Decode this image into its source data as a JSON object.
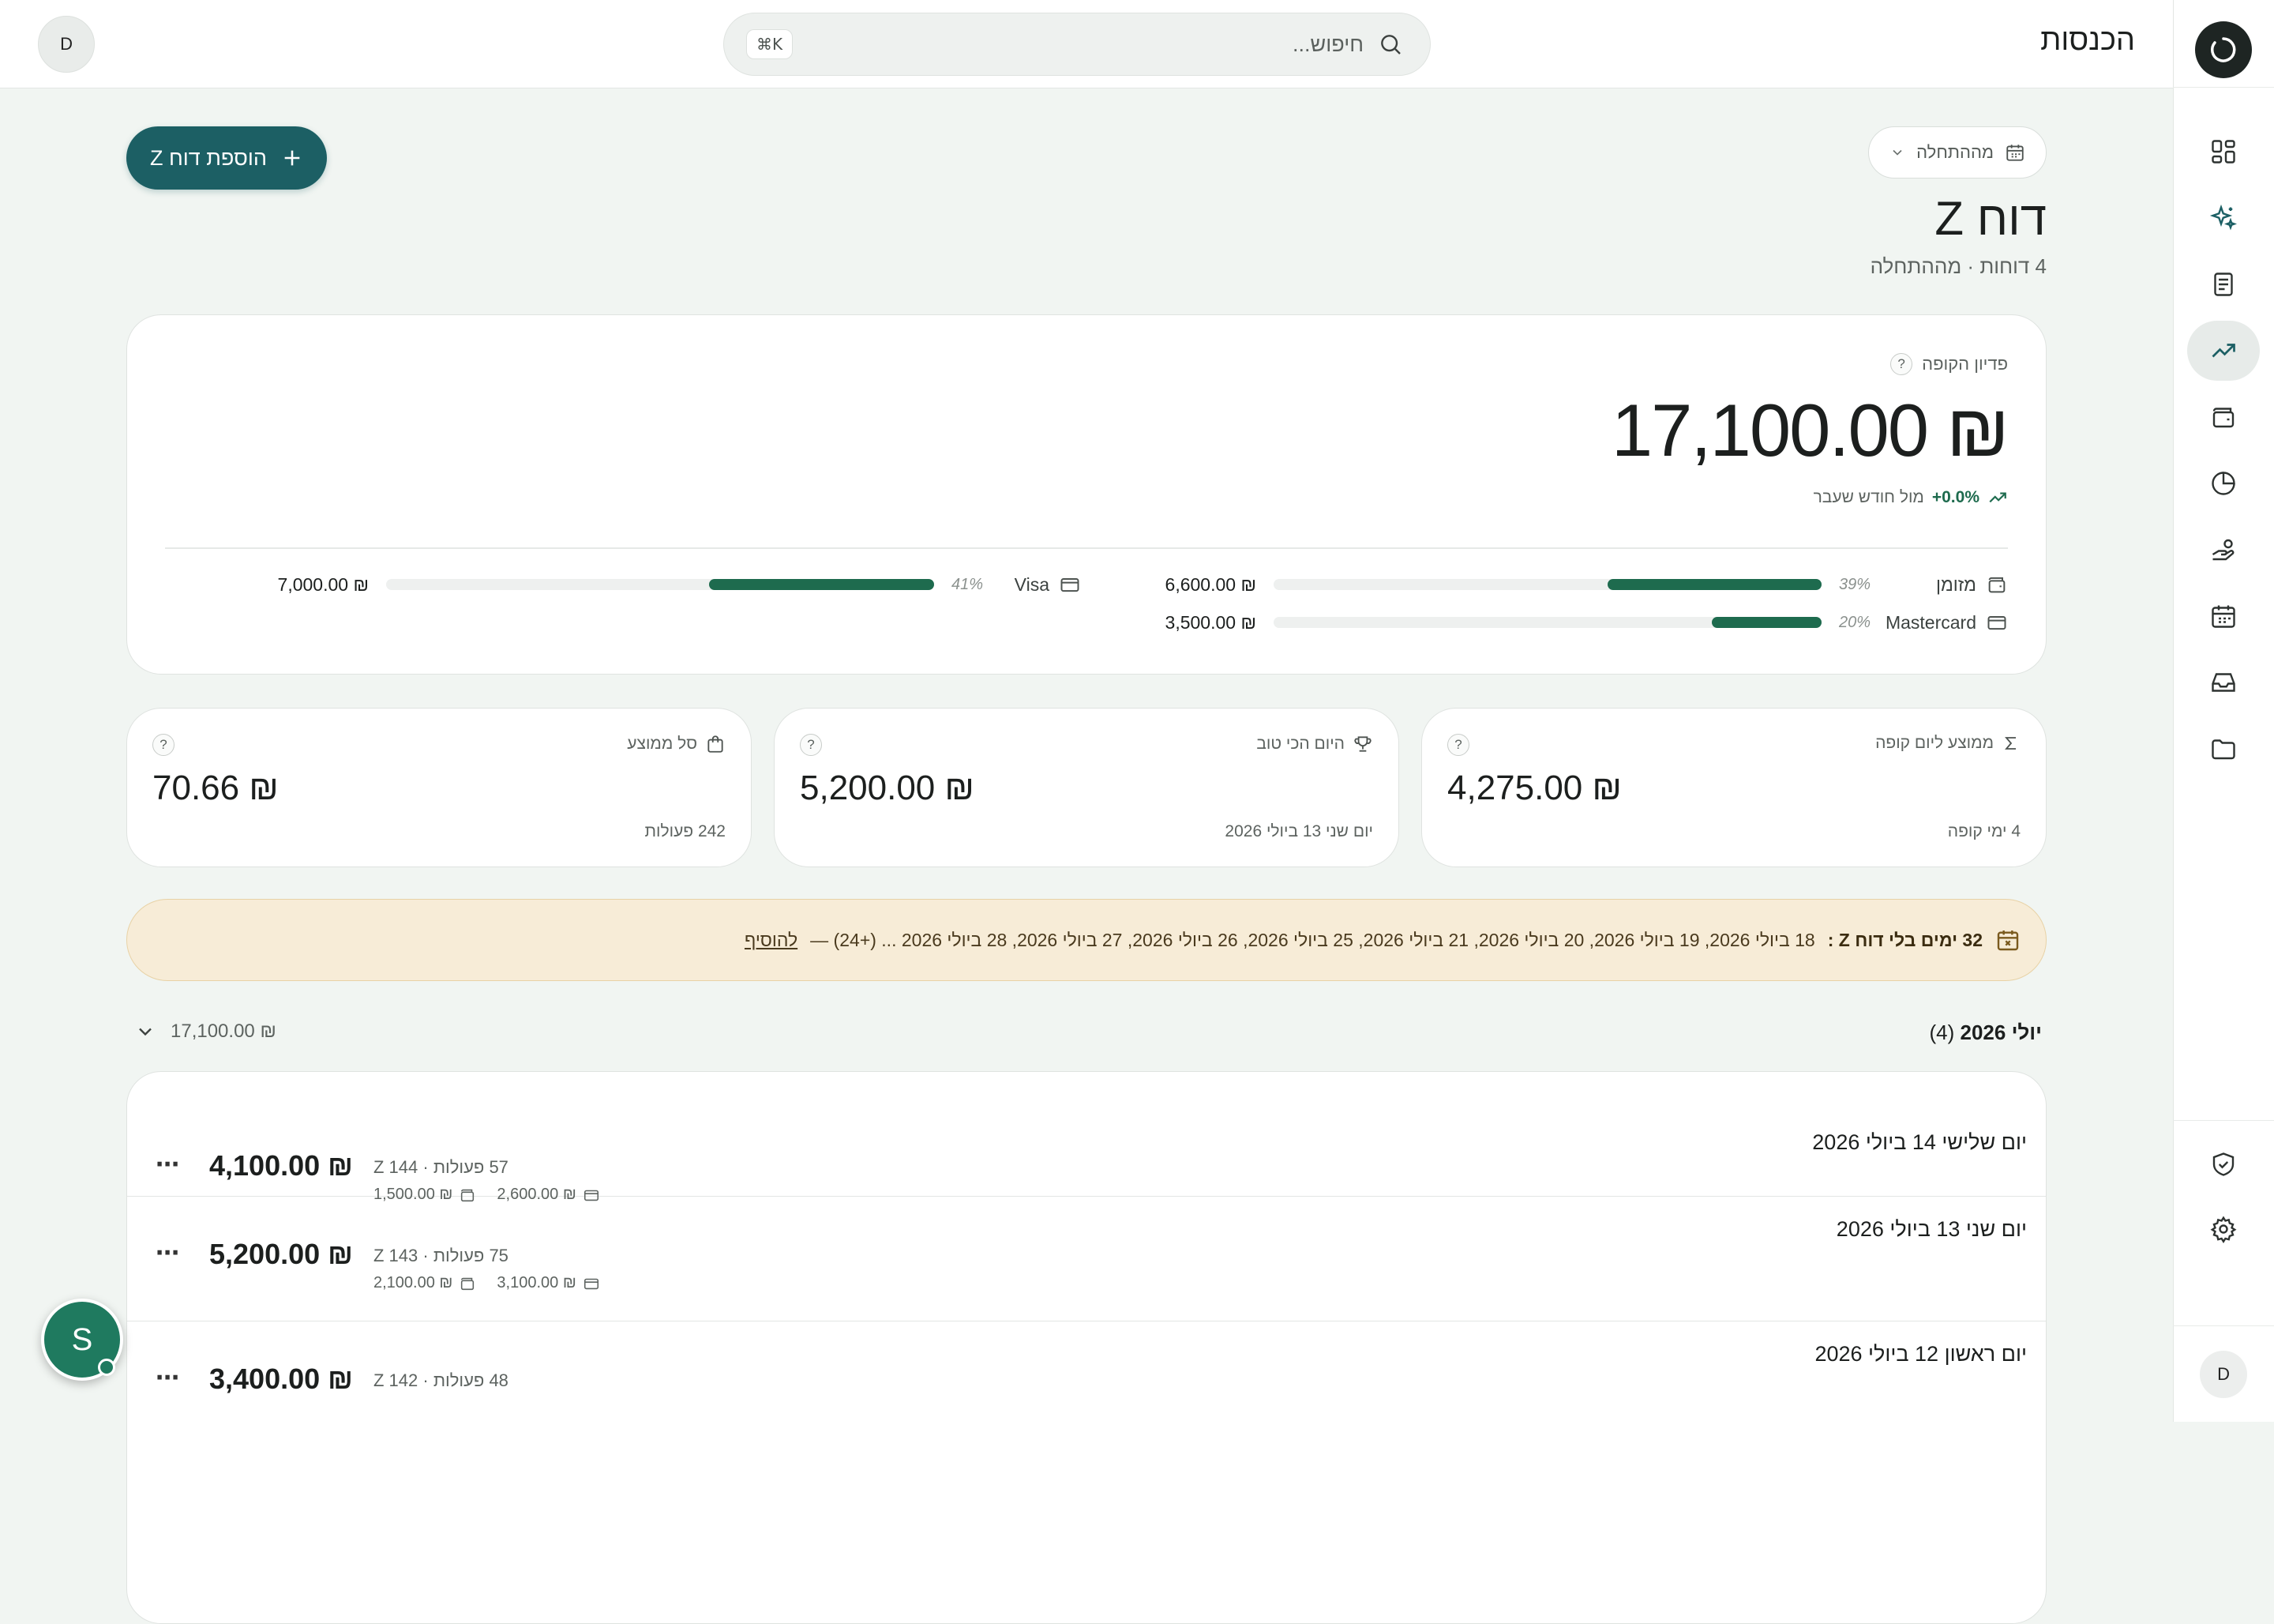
{
  "app": {
    "title": "הכנסות",
    "brand_color": "#1c5f64",
    "accent_green": "#1e6b4e"
  },
  "topbar": {
    "search_placeholder": "חיפוש...",
    "shortcut": "⌘K",
    "avatar_initial": "D"
  },
  "sidebar": {
    "items": [
      {
        "icon": "dashboard-grid-icon"
      },
      {
        "icon": "sparkles-icon"
      },
      {
        "icon": "receipt-icon"
      },
      {
        "icon": "trending-up-icon",
        "active": true
      },
      {
        "icon": "wallet-icon"
      },
      {
        "icon": "pie-chart-icon"
      },
      {
        "icon": "hand-coins-icon"
      },
      {
        "icon": "calendar-icon"
      },
      {
        "icon": "inbox-icon"
      },
      {
        "icon": "folder-icon"
      }
    ],
    "bottom": [
      {
        "icon": "shield-check-icon"
      },
      {
        "icon": "settings-gear-icon"
      }
    ],
    "user_initial": "D"
  },
  "header": {
    "period_label": "מההתחלה",
    "add_button": "הוספת דוח Z",
    "title": "דוח Z",
    "subtitle": "4 דוחות · מההתחלה"
  },
  "revenue": {
    "label": "פדיון הקופה",
    "help": "?",
    "amount": "₪ 17,100.00",
    "trend_pct": "+0.0%",
    "trend_text": "מול חודש שעבר",
    "methods": [
      {
        "name": "מזומן",
        "pct": "39%",
        "pct_value": 0.39,
        "value": "₪ 6,600.00"
      },
      {
        "name": "Mastercard",
        "pct": "20%",
        "pct_value": 0.2,
        "value": "₪ 3,500.00"
      },
      {
        "name": "Visa",
        "pct": "41%",
        "pct_value": 0.41,
        "value": "₪ 7,000.00"
      }
    ]
  },
  "stats": [
    {
      "label": "ממוצע ליום קופה",
      "value": "₪ 4,275.00",
      "sub": "4 ימי קופה",
      "icon": "sigma-icon"
    },
    {
      "label": "היום הכי טוב",
      "value": "₪ 5,200.00",
      "sub": "יום שני 13 ביולי 2026",
      "icon": "trophy-icon"
    },
    {
      "label": "סל ממוצע",
      "value": "₪ 70.66",
      "sub": "242 פעולות",
      "icon": "shopping-bag-icon"
    }
  ],
  "warning": {
    "strong": "32 ימים בלי דוח Z :",
    "dates": "18 ביולי 2026, 19 ביולי 2026, 20 ביולי 2026, 21 ביולי 2026, 25 ביולי 2026, 26 ביולי 2026, 27 ביולי 2026, 28 ביולי 2026 ... (+24) —",
    "link": "להוסיף"
  },
  "month": {
    "name": "יולי 2026",
    "count": "(4)",
    "total": "₪ 17,100.00"
  },
  "days": [
    {
      "date": "יום שלישי 14 ביולי 2026",
      "amount": "₪ 4,100.00",
      "meta": "57 פעולות · Z 144",
      "card": "₪ 2,600.00",
      "cash": "₪ 1,500.00"
    },
    {
      "date": "יום שני 13 ביולי 2026",
      "amount": "₪ 5,200.00",
      "meta": "75 פעולות · Z 143",
      "card": "₪ 3,100.00",
      "cash": "₪ 2,100.00"
    },
    {
      "date": "יום ראשון 12 ביולי 2026",
      "amount": "₪ 3,400.00",
      "meta": "48 פעולות · Z 142",
      "card": "",
      "cash": ""
    }
  ],
  "support": {
    "initial": "S"
  }
}
